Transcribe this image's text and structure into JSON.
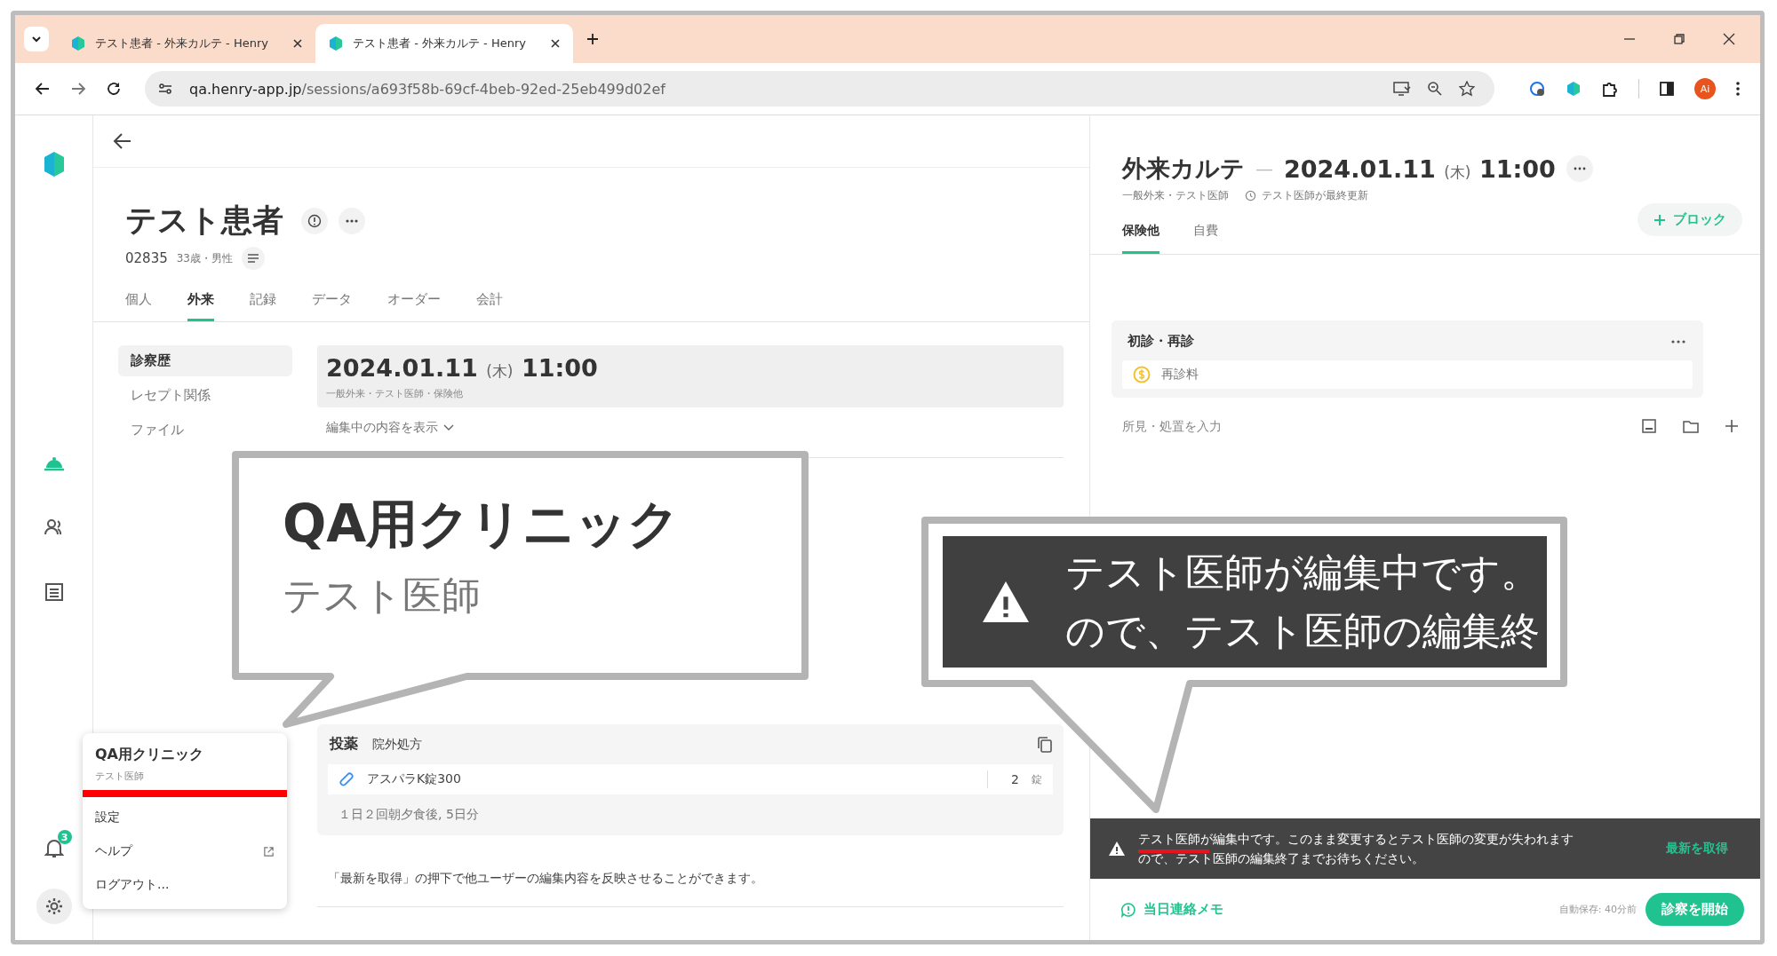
{
  "browser": {
    "tabs": [
      {
        "title": "テスト患者 - 外来カルテ - Henry",
        "selected": false
      },
      {
        "title": "テスト患者 - 外来カルテ - Henry",
        "selected": true
      }
    ],
    "url_host": "qa.henry-app.jp",
    "url_path": "/sessions/a693f58b-69cf-4beb-92ed-25eb499d02ef",
    "profile": "Ai"
  },
  "nav_rail": {
    "notification_count": "3"
  },
  "patient": {
    "name": "テスト患者",
    "id": "02835",
    "details": "33歳・男性",
    "tabs": [
      {
        "label": "個人",
        "selected": false
      },
      {
        "label": "外来",
        "selected": true
      },
      {
        "label": "記録",
        "selected": false
      },
      {
        "label": "データ",
        "selected": false
      },
      {
        "label": "オーダー",
        "selected": false
      },
      {
        "label": "会計",
        "selected": false
      }
    ]
  },
  "side_menu": [
    {
      "label": "診察歴",
      "selected": true
    },
    {
      "label": "レセプト関係",
      "selected": false
    },
    {
      "label": "ファイル",
      "selected": false
    }
  ],
  "session": {
    "date": "2024.01.11",
    "weekday": "(木)",
    "time": "11:00",
    "meta": "一般外来・テスト医師・保険他",
    "expand_link": "編集中の内容を表示"
  },
  "prescription": {
    "title": "投薬",
    "type": "院外処方",
    "drug": "アスパラK錠300",
    "quantity": "2",
    "unit": "錠",
    "dosage": "１日２回朝夕食後, 5日分"
  },
  "note": "「最新を取得」の押下で他ユーザーの編集内容を反映させることができます。",
  "account_menu": {
    "clinic": "QA用クリニック",
    "user": "テスト医師",
    "items": [
      {
        "label": "設定",
        "kind": "plain"
      },
      {
        "label": "ヘルプ",
        "kind": "external"
      },
      {
        "label": "ログアウト...",
        "kind": "plain"
      }
    ]
  },
  "record": {
    "title": "外来カルテ",
    "separator": "—",
    "date": "2024.01.11",
    "weekday": "(木)",
    "time": "11:00",
    "meta": "一般外来・テスト医師",
    "updated": "テスト医師が最終更新",
    "tabs": [
      {
        "label": "保険他",
        "selected": true
      },
      {
        "label": "自費",
        "selected": false
      }
    ],
    "add_block": "ブロック",
    "card": {
      "title": "初診・再診",
      "item": "再診料"
    },
    "input_placeholder": "所見・処置を入力"
  },
  "edit_banner": {
    "lines": [
      "テスト医師が編集中です。このまま変更するとテスト医師の変更が失われます",
      "ので、テスト医師の編集終了までお待ちください。"
    ],
    "action": "最新を取得"
  },
  "footer": {
    "memo": "当日連絡メモ",
    "autosave": "自動保存: 40分前",
    "start": "診察を開始"
  },
  "callouts": [
    {
      "kind": "account",
      "title": "QA用クリニック",
      "subtitle": "テスト医師"
    },
    {
      "kind": "warning",
      "lines": [
        "テスト医師が編集中です。",
        "ので、テスト医師の編集終"
      ]
    }
  ]
}
